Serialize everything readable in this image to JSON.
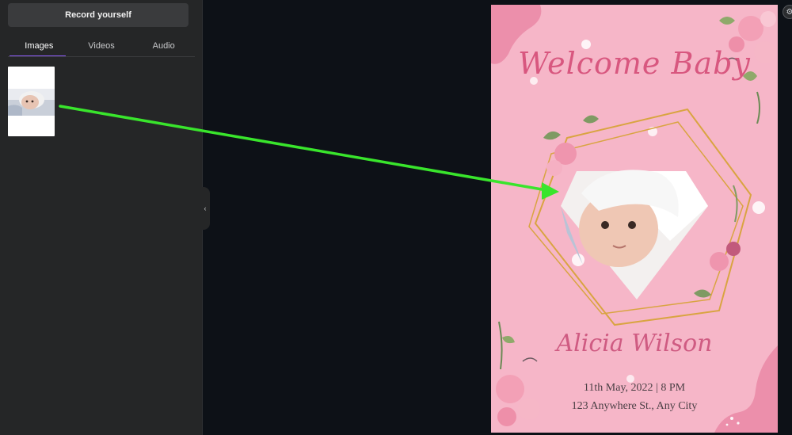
{
  "panel": {
    "record_label": "Record yourself",
    "tabs": [
      {
        "label": "Images",
        "active": true
      },
      {
        "label": "Videos",
        "active": false
      },
      {
        "label": "Audio",
        "active": false
      }
    ],
    "accent_color": "#8b5cf6"
  },
  "invitation": {
    "title": "Welcome Baby",
    "name": "Alicia Wilson",
    "date": "11th May, 2022 | 8 PM",
    "address": "123 Anywhere St., Any City",
    "background_color": "#f6b6c8",
    "title_color": "#d8577f"
  },
  "annotation": {
    "arrow_color": "#39e52c"
  },
  "icons": {
    "collapse": "chevron-left-icon",
    "corner": "settings-icon"
  }
}
